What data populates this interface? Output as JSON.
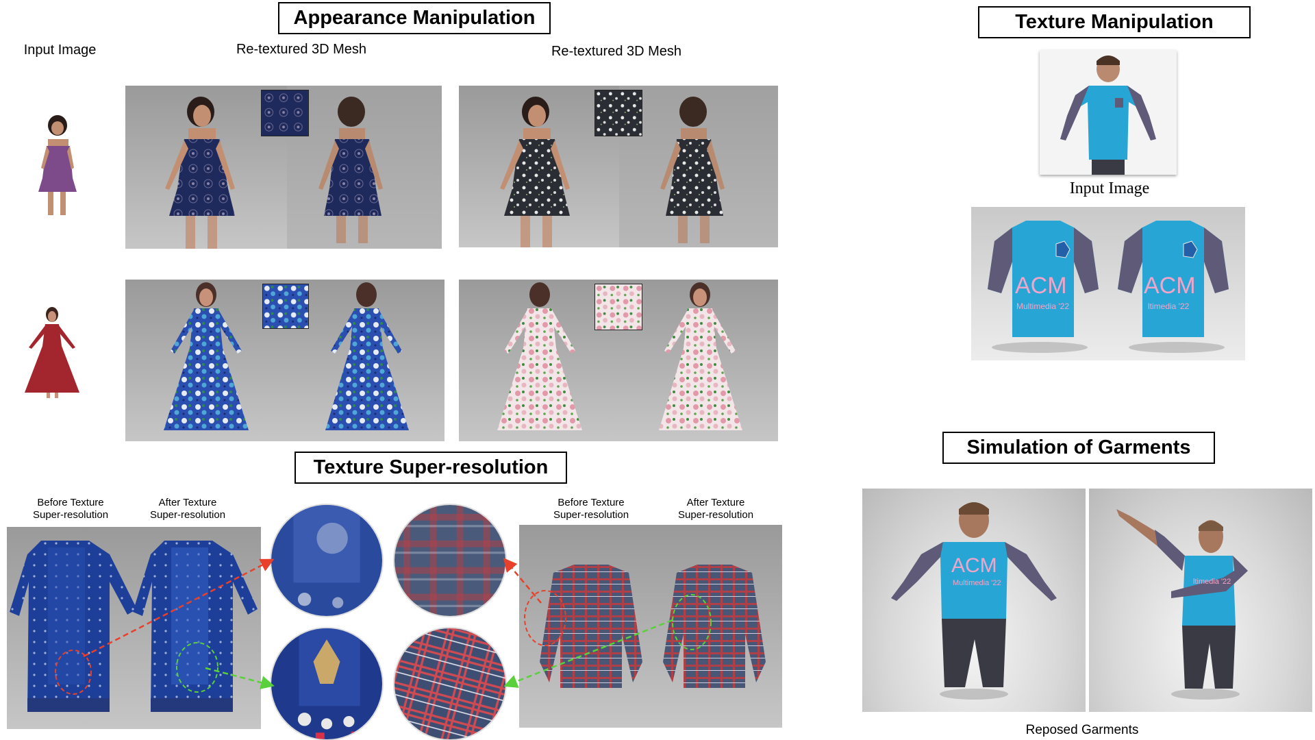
{
  "titles": {
    "appearance": "Appearance Manipulation",
    "texture_manip": "Texture Manipulation",
    "super_res": "Texture Super-resolution",
    "simulation": "Simulation of Garments"
  },
  "captions": {
    "input_image": "Input Image",
    "retextured_1": "Re-textured 3D Mesh",
    "retextured_2": "Re-textured 3D Mesh",
    "input_image_serif": "Input Image",
    "reposed": "Reposed Garments",
    "before_1_line1": "Before Texture",
    "before_1_line2": "Super-resolution",
    "after_1_line1": "After Texture",
    "after_1_line2": "Super-resolution",
    "before_2_line1": "Before Texture",
    "before_2_line2": "Super-resolution",
    "after_2_line1": "After Texture",
    "after_2_line2": "Super-resolution"
  },
  "shirt_print": {
    "logo": "ACM",
    "sub": "Multimedia '22",
    "logo_cut": "ACM",
    "sub_cut": "ltimedia '22"
  },
  "colors": {
    "navy_dress": "#1f2a5c",
    "black_floral": "#2a2d33",
    "blue_floral": "#2b4fb0",
    "pink_floral": "#e9c9cf",
    "shirt_cyan": "#27a6d6",
    "sleeve_purple": "#5e5a78",
    "kurta_blue": "#1d3f9a",
    "plaid_red": "#b04048",
    "arrow_red": "#e8402a",
    "arrow_green": "#5ad13a"
  }
}
